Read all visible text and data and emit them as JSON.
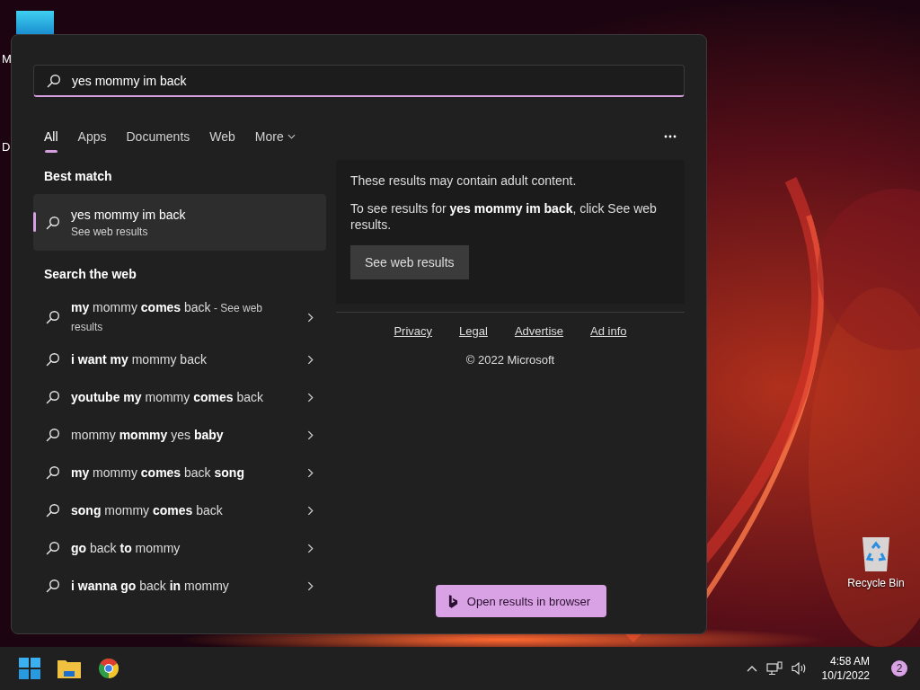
{
  "desktop": {
    "icon_labels": [
      "M",
      "D"
    ],
    "recycle_bin": {
      "label": "Recycle Bin"
    }
  },
  "search": {
    "value": "yes mommy im back"
  },
  "tabs": [
    {
      "label": "All",
      "selected": true
    },
    {
      "label": "Apps",
      "selected": false
    },
    {
      "label": "Documents",
      "selected": false
    },
    {
      "label": "Web",
      "selected": false
    },
    {
      "label": "More",
      "selected": false,
      "dropdown": true
    }
  ],
  "best_match": {
    "heading": "Best match",
    "title": "yes mommy im back",
    "subtitle": "See web results",
    "selected": true
  },
  "web": {
    "heading": "Search the web",
    "suggestions": [
      {
        "text": "**my** mommy **comes** back",
        "suffix": " - See web results"
      },
      {
        "text": "**i want my** mommy back"
      },
      {
        "text": "**youtube my** mommy **comes** back"
      },
      {
        "text": "mommy **mommy** yes **baby**"
      },
      {
        "text": "**my** mommy **comes** back **song**"
      },
      {
        "text": "**song** mommy **comes** back"
      },
      {
        "text": "**go** back **to** mommy"
      },
      {
        "text": "**i wanna go** back **in** mommy"
      }
    ]
  },
  "notice": {
    "warning": "These results may contain adult content.",
    "message": "To see results for **yes mommy im back**, click See web results.",
    "button": "See web results"
  },
  "footer": {
    "links": [
      "Privacy",
      "Legal",
      "Advertise",
      "Ad info"
    ],
    "copyright": "© 2022 Microsoft"
  },
  "open_browser_button": "Open results in browser",
  "taskbar": {
    "time": "4:58 AM",
    "date": "10/1/2022",
    "notifications": "2"
  }
}
